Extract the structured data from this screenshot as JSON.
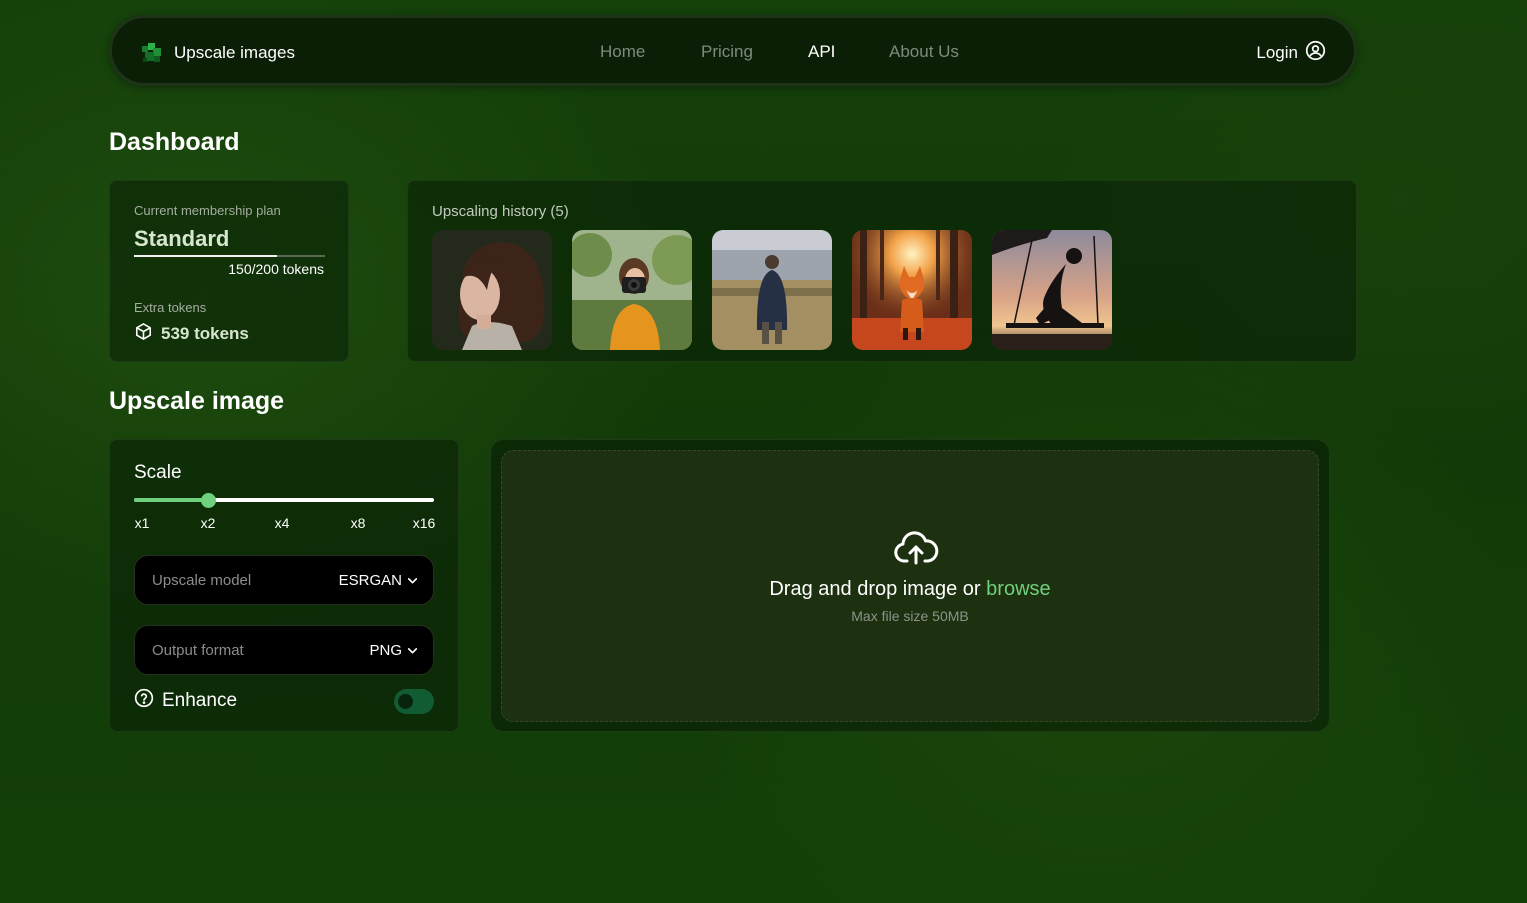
{
  "nav": {
    "brand": "Upscale images",
    "links": [
      "Home",
      "Pricing",
      "API",
      "About Us"
    ],
    "active": "API",
    "login": "Login"
  },
  "dashboard": {
    "title": "Dashboard",
    "plan": {
      "label": "Current membership plan",
      "name": "Standard",
      "tokens_text": "150/200 tokens",
      "used": 150,
      "total": 200
    },
    "extra": {
      "label": "Extra tokens",
      "value": "539 tokens"
    },
    "history": {
      "title": "Upscaling history (5)",
      "items": [
        {
          "name": "history-thumb-girl-profile"
        },
        {
          "name": "history-thumb-photographer"
        },
        {
          "name": "history-thumb-man-field"
        },
        {
          "name": "history-thumb-fox-forest"
        },
        {
          "name": "history-thumb-swing-silhouette"
        }
      ]
    }
  },
  "upscale": {
    "title": "Upscale image",
    "scale": {
      "label": "Scale",
      "options": [
        "x1",
        "x2",
        "x4",
        "x8",
        "x16"
      ],
      "selected": "x2",
      "selected_index": 1
    },
    "model": {
      "label": "Upscale model",
      "value": "ESRGAN"
    },
    "format": {
      "label": "Output format",
      "value": "PNG"
    },
    "enhance": {
      "label": "Enhance",
      "enabled": false
    },
    "dropzone": {
      "text": "Drag and drop image or ",
      "browse": "browse",
      "sub": "Max file size 50MB"
    }
  },
  "colors": {
    "accent": "#6fd07d",
    "background": "#14400a",
    "card": "#0a1f06"
  }
}
